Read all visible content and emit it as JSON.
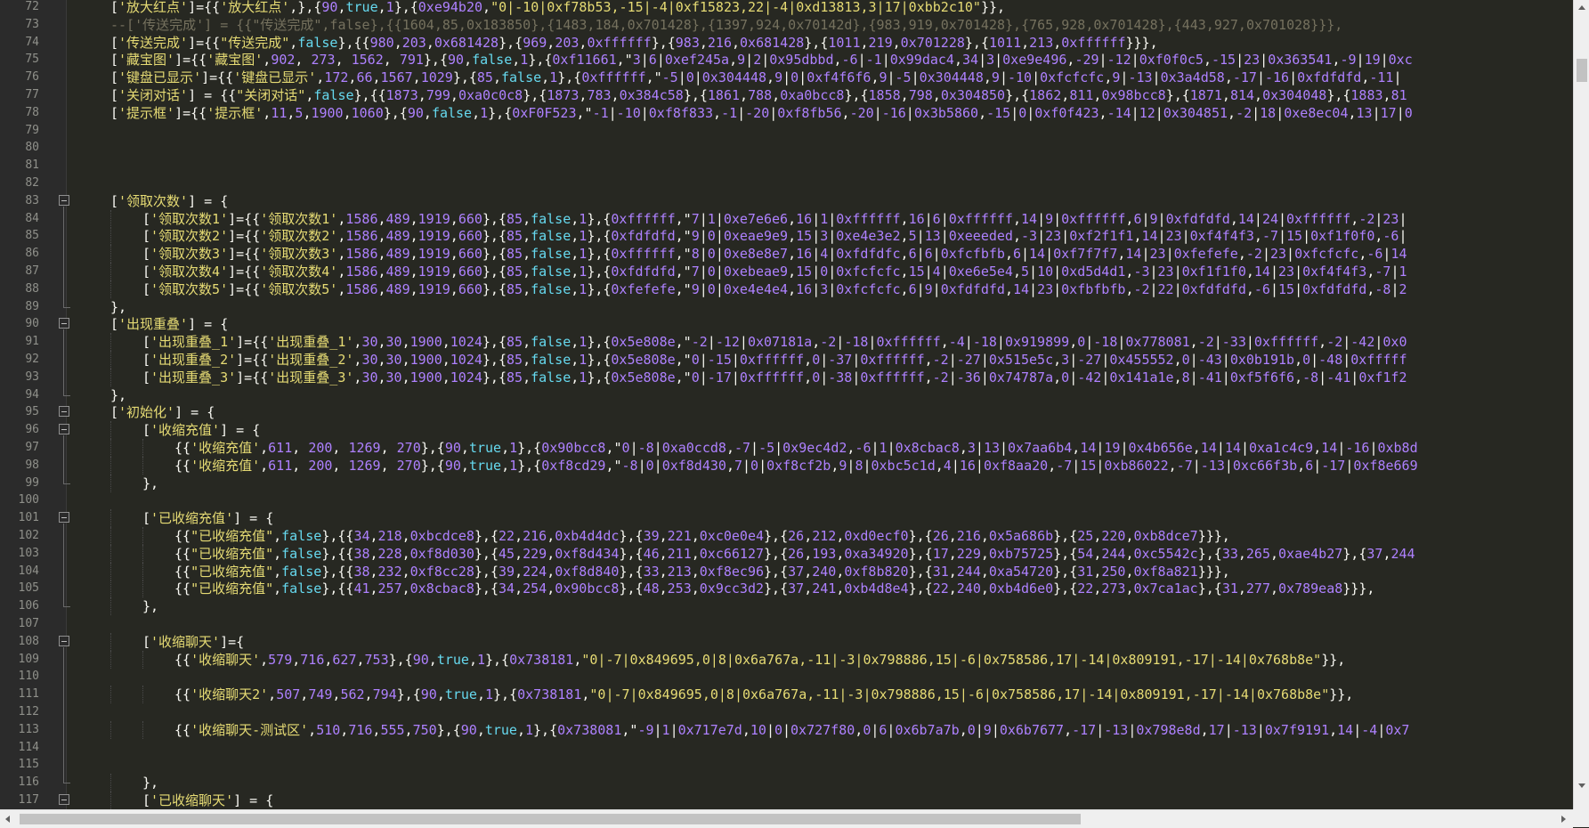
{
  "editor": {
    "lines": [
      {
        "num": "72",
        "indent": 1,
        "fold": "",
        "text": "['放大红点']={{'放大红点',},{90,true,1},{0xe94b20,\"0|-10|0xf78b53,-15|-4|0xf15823,22|-4|0xd13813,3|17|0xbb2c10\"}},"
      },
      {
        "num": "73",
        "indent": 1,
        "fold": "",
        "text": "--['传送完成'] = {{\"传送完成\",false},{{1604,85,0x183850},{1483,184,0x701428},{1397,924,0x70142d},{983,919,0x701428},{765,928,0x701428},{443,927,0x701028}}},"
      },
      {
        "num": "74",
        "indent": 1,
        "fold": "",
        "text": "['传送完成']={{\"传送完成\",false},{{980,203,0x681428},{969,203,0xffffff},{983,216,0x681428},{1011,219,0x701228},{1011,213,0xffffff}}},"
      },
      {
        "num": "75",
        "indent": 1,
        "fold": "",
        "text": "['藏宝图']={{'藏宝图',902, 273, 1562, 791},{90,false,1},{0xf11661,\"3|6|0xef245a,9|2|0x95dbbd,-6|-1|0x99dac4,34|3|0xe9e496,-29|-12|0xf0f0c5,-15|23|0x363541,-9|19|0xc"
      },
      {
        "num": "76",
        "indent": 1,
        "fold": "",
        "text": "['键盘已显示']={{'键盘已显示',172,66,1567,1029},{85,false,1},{0xffffff,\"-5|0|0x304448,9|0|0xf4f6f6,9|-5|0x304448,9|-10|0xfcfcfc,9|-13|0x3a4d58,-17|-16|0xfdfdfd,-11|"
      },
      {
        "num": "77",
        "indent": 1,
        "fold": "",
        "text": "['关闭对话'] = {{\"关闭对话\",false},{{1873,799,0xa0c0c8},{1873,783,0x384c58},{1861,788,0xa0bcc8},{1858,798,0x304850},{1862,811,0x98bcc8},{1871,814,0x304048},{1883,81"
      },
      {
        "num": "78",
        "indent": 1,
        "fold": "",
        "text": "['提示框']={{'提示框',11,5,1900,1060},{90,false,1},{0xF0F523,\"-1|-10|0xf8f833,-1|-20|0xf8fb56,-20|-16|0x3b5860,-15|0|0xf0f423,-14|12|0x304851,-2|18|0xe8ec04,13|17|0"
      },
      {
        "num": "79",
        "indent": 0,
        "fold": "",
        "text": ""
      },
      {
        "num": "80",
        "indent": 0,
        "fold": "",
        "text": ""
      },
      {
        "num": "81",
        "indent": 0,
        "fold": "",
        "text": ""
      },
      {
        "num": "82",
        "indent": 0,
        "fold": "",
        "text": ""
      },
      {
        "num": "83",
        "indent": 1,
        "fold": "open",
        "text": "['领取次数'] = {"
      },
      {
        "num": "84",
        "indent": 2,
        "fold": "",
        "text": "['领取次数1']={{'领取次数1',1586,489,1919,660},{85,false,1},{0xffffff,\"7|1|0xe7e6e6,16|1|0xffffff,16|6|0xffffff,14|9|0xffffff,6|9|0xfdfdfd,14|24|0xffffff,-2|23|"
      },
      {
        "num": "85",
        "indent": 2,
        "fold": "",
        "text": "['领取次数2']={{'领取次数2',1586,489,1919,660},{85,false,1},{0xfdfdfd,\"9|0|0xeae9e9,15|3|0xe4e3e2,5|13|0xeeeded,-3|23|0xf2f1f1,14|23|0xf4f4f3,-7|15|0xf1f0f0,-6|"
      },
      {
        "num": "86",
        "indent": 2,
        "fold": "",
        "text": "['领取次数3']={{'领取次数3',1586,489,1919,660},{85,false,1},{0xffffff,\"8|0|0xe8e8e7,16|4|0xfdfdfc,6|6|0xfcfbfb,6|14|0xf7f7f7,14|23|0xfefefe,-2|23|0xfcfcfc,-6|14"
      },
      {
        "num": "87",
        "indent": 2,
        "fold": "",
        "text": "['领取次数4']={{'领取次数4',1586,489,1919,660},{85,false,1},{0xfdfdfd,\"7|0|0xebeae9,15|0|0xfcfcfc,15|4|0xe6e5e4,5|10|0xd5d4d1,-3|23|0xf1f1f0,14|23|0xf4f4f3,-7|1"
      },
      {
        "num": "88",
        "indent": 2,
        "fold": "",
        "text": "['领取次数5']={{'领取次数5',1586,489,1919,660},{85,false,1},{0xfefefe,\"9|0|0xe4e4e4,16|3|0xfcfcfc,6|9|0xfdfdfd,14|23|0xfbfbfb,-2|22|0xfdfdfd,-6|15|0xfdfdfd,-8|2"
      },
      {
        "num": "89",
        "indent": 1,
        "fold": "end",
        "text": "},"
      },
      {
        "num": "90",
        "indent": 1,
        "fold": "open",
        "text": "['出现重叠'] = {"
      },
      {
        "num": "91",
        "indent": 2,
        "fold": "",
        "text": "['出现重叠_1']={{'出现重叠_1',30,30,1900,1024},{85,false,1},{0x5e808e,\"-2|-12|0x07181a,-2|-18|0xffffff,-4|-18|0x919899,0|-18|0x778081,-2|-33|0xffffff,-2|-42|0x0"
      },
      {
        "num": "92",
        "indent": 2,
        "fold": "",
        "text": "['出现重叠_2']={{'出现重叠_2',30,30,1900,1024},{85,false,1},{0x5e808e,\"0|-15|0xffffff,0|-37|0xffffff,-2|-27|0x515e5c,3|-27|0x455552,0|-43|0x0b191b,0|-48|0xfffff"
      },
      {
        "num": "93",
        "indent": 2,
        "fold": "",
        "text": "['出现重叠_3']={{'出现重叠_3',30,30,1900,1024},{85,false,1},{0x5e808e,\"0|-17|0xffffff,0|-38|0xffffff,-2|-36|0x74787a,0|-42|0x141a1e,8|-41|0xf5f6f6,-8|-41|0xf1f2"
      },
      {
        "num": "94",
        "indent": 1,
        "fold": "end",
        "text": "},"
      },
      {
        "num": "95",
        "indent": 1,
        "fold": "open",
        "text": "['初始化'] = {"
      },
      {
        "num": "96",
        "indent": 2,
        "fold": "open",
        "text": "['收缩充值'] = {"
      },
      {
        "num": "97",
        "indent": 3,
        "fold": "",
        "text": "{{'收缩充值',611, 200, 1269, 270},{90,true,1},{0x90bcc8,\"0|-8|0xa0ccd8,-7|-5|0x9ec4d2,-6|1|0x8cbac8,3|13|0x7aa6b4,14|19|0x4b656e,14|14|0xa1c4c9,14|-16|0xb8d"
      },
      {
        "num": "98",
        "indent": 3,
        "fold": "",
        "text": "{{'收缩充值',611, 200, 1269, 270},{90,true,1},{0xf8cd29,\"-8|0|0xf8d430,7|0|0xf8cf2b,9|8|0xbc5c1d,4|16|0xf8aa20,-7|15|0xb86022,-7|-13|0xc66f3b,6|-17|0xf8e669"
      },
      {
        "num": "99",
        "indent": 2,
        "fold": "end",
        "text": "},"
      },
      {
        "num": "100",
        "indent": 0,
        "fold": "",
        "text": ""
      },
      {
        "num": "101",
        "indent": 2,
        "fold": "open",
        "text": "['已收缩充值'] = {"
      },
      {
        "num": "102",
        "indent": 3,
        "fold": "",
        "text": "{{\"已收缩充值\",false},{{34,218,0xbcdce8},{22,216,0xb4d4dc},{39,221,0xc0e0e4},{26,212,0xd0ecf0},{26,216,0x5a686b},{25,220,0xb8dce7}}},"
      },
      {
        "num": "103",
        "indent": 3,
        "fold": "",
        "text": "{{\"已收缩充值\",false},{{38,228,0xf8d030},{45,229,0xf8d434},{46,211,0xc66127},{26,193,0xa34920},{17,229,0xb75725},{54,244,0xc5542c},{33,265,0xae4b27},{37,244"
      },
      {
        "num": "104",
        "indent": 3,
        "fold": "",
        "text": "{{\"已收缩充值\",false},{{38,232,0xf8cc28},{39,224,0xf8d840},{33,213,0xf8ec96},{37,240,0xf8b820},{31,244,0xa54720},{31,250,0xf8a821}}},"
      },
      {
        "num": "105",
        "indent": 3,
        "fold": "",
        "text": "{{\"已收缩充值\",false},{{41,257,0x8cbac8},{34,254,0x90bcc8},{48,253,0x9cc3d2},{37,241,0xb4d8e4},{22,240,0xb4d6e0},{22,273,0x7ca1ac},{31,277,0x789ea8}}},"
      },
      {
        "num": "106",
        "indent": 2,
        "fold": "end",
        "text": "},"
      },
      {
        "num": "107",
        "indent": 0,
        "fold": "",
        "text": ""
      },
      {
        "num": "108",
        "indent": 2,
        "fold": "open",
        "text": "['收缩聊天']={"
      },
      {
        "num": "109",
        "indent": 3,
        "fold": "",
        "text": "{{'收缩聊天',579,716,627,753},{90,true,1},{0x738181,\"0|-7|0x849695,0|8|0x6a767a,-11|-3|0x798886,15|-6|0x758586,17|-14|0x809191,-17|-14|0x768b8e\"}},"
      },
      {
        "num": "110",
        "indent": 0,
        "fold": "",
        "text": ""
      },
      {
        "num": "111",
        "indent": 3,
        "fold": "",
        "text": "{{'收缩聊天2',507,749,562,794},{90,true,1},{0x738181,\"0|-7|0x849695,0|8|0x6a767a,-11|-3|0x798886,15|-6|0x758586,17|-14|0x809191,-17|-14|0x768b8e\"}},"
      },
      {
        "num": "112",
        "indent": 0,
        "fold": "",
        "text": ""
      },
      {
        "num": "113",
        "indent": 3,
        "fold": "",
        "text": "{{'收缩聊天-测试区',510,716,555,750},{90,true,1},{0x738081,\"-9|1|0x717e7d,10|0|0x727f80,0|6|0x6b7a7b,0|9|0x6b7677,-17|-13|0x798e8d,17|-13|0x7f9191,14|-4|0x7"
      },
      {
        "num": "114",
        "indent": 0,
        "fold": "",
        "text": ""
      },
      {
        "num": "115",
        "indent": 0,
        "fold": "",
        "text": ""
      },
      {
        "num": "116",
        "indent": 2,
        "fold": "end",
        "text": "},"
      },
      {
        "num": "117",
        "indent": 2,
        "fold": "open",
        "text": "['已收缩聊天'] = {"
      }
    ]
  },
  "colors": {
    "background": "#272822",
    "gutter": "#2b2b2b",
    "string": "#e6db74",
    "number": "#ae81ff",
    "keyword": "#66d9ef",
    "comment": "#75715e"
  }
}
